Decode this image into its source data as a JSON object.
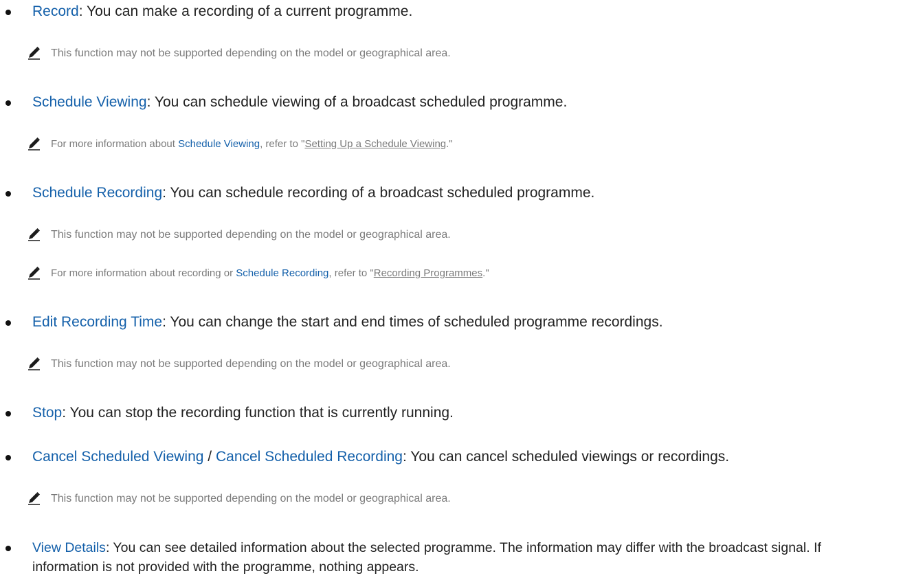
{
  "items": [
    {
      "term": "Record",
      "desc": ": You can make a recording of a current programme.",
      "notes": [
        {
          "type": "plain",
          "text": "This function may not be supported depending on the model or geographical area."
        }
      ]
    },
    {
      "term": "Schedule Viewing",
      "desc": ": You can schedule viewing of a broadcast scheduled programme.",
      "notes": [
        {
          "type": "ref",
          "pre": "For more information about ",
          "term": "Schedule Viewing",
          "mid": ", refer to \"",
          "link": "Setting Up a Schedule Viewing",
          "post": ".\""
        }
      ]
    },
    {
      "term": "Schedule Recording",
      "desc": ": You can schedule recording of a broadcast scheduled programme.",
      "notes": [
        {
          "type": "plain",
          "text": "This function may not be supported depending on the model or geographical area."
        },
        {
          "type": "ref",
          "pre": "For more information about recording or ",
          "term": "Schedule Recording",
          "mid": ", refer to \"",
          "link": "Recording Programmes",
          "post": ".\""
        }
      ]
    },
    {
      "term": "Edit Recording Time",
      "desc": ": You can change the start and end times of scheduled programme recordings.",
      "notes": [
        {
          "type": "plain",
          "text": "This function may not be supported depending on the model or geographical area."
        }
      ]
    },
    {
      "term": "Stop",
      "desc": ": You can stop the recording function that is currently running.",
      "notes": []
    },
    {
      "term": "Cancel Scheduled Viewing",
      "sep": " / ",
      "term2": "Cancel Scheduled Recording",
      "desc": ": You can cancel scheduled viewings or recordings.",
      "notes": [
        {
          "type": "plain",
          "text": "This function may not be supported depending on the model or geographical area."
        }
      ]
    },
    {
      "term": "View Details",
      "desc": ": You can see detailed information about the selected programme. The information may differ with the broadcast signal. If information is not provided with the programme, nothing appears.",
      "notes": []
    }
  ],
  "colors": {
    "term": "#1460aa",
    "body_text": "#222222",
    "note_text": "#7a7a7a",
    "bullet": "#111111"
  },
  "icons": {
    "note": "pencil-icon",
    "bullet": "bullet-dot"
  }
}
